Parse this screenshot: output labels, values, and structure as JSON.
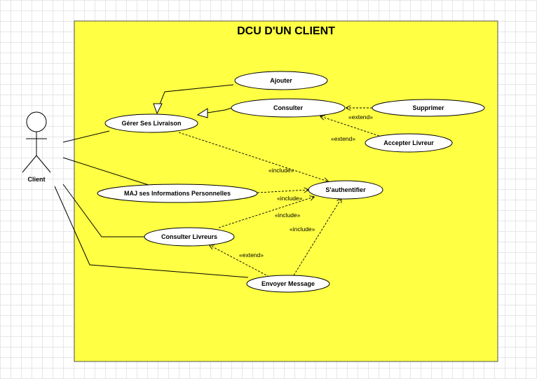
{
  "system": {
    "title": "DCU D'UN CLIENT",
    "fill": "#ffff44"
  },
  "actor": {
    "label": "Client"
  },
  "use_cases": {
    "ajouter": "Ajouter",
    "consulter": "Consulter",
    "supprimer": "Supprimer",
    "accepter_livreur": "Accepter Livreur",
    "gerer_livraison": "Gérer Ses Livraison",
    "maj_infos": "MAJ ses Informations Personnelles",
    "authentifier": "S'authentifier",
    "consulter_livreurs": "Consulter Livreurs",
    "envoyer_message": "Envoyer Message"
  },
  "stereotypes": {
    "extend": "«extend»",
    "include": "«include»"
  }
}
